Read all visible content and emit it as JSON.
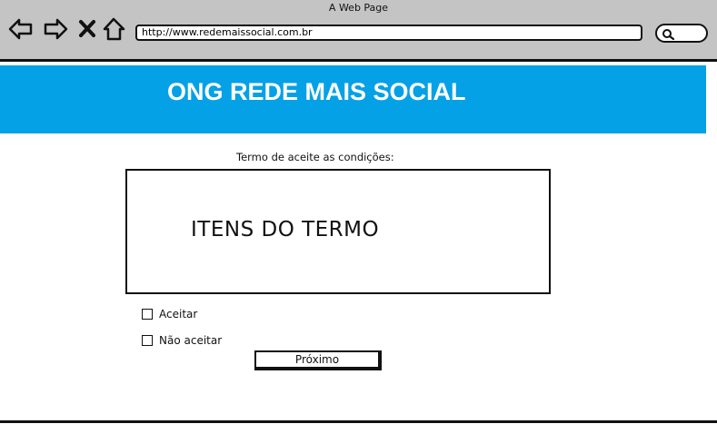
{
  "browser": {
    "window_title": "A Web Page",
    "url": "http://www.redemaissocial.com.br",
    "icons": [
      "back-arrow-icon",
      "forward-arrow-icon",
      "close-x-icon",
      "home-icon",
      "search-icon"
    ]
  },
  "header": {
    "title": "ONG REDE MAIS SOCIAL",
    "background_color": "#05a1e6"
  },
  "terms": {
    "label": "Termo de aceite as condições:",
    "content": "ITENS DO TERMO"
  },
  "options": {
    "accept_label": "Aceitar",
    "reject_label": "Não aceitar"
  },
  "actions": {
    "next_label": "Próximo"
  }
}
